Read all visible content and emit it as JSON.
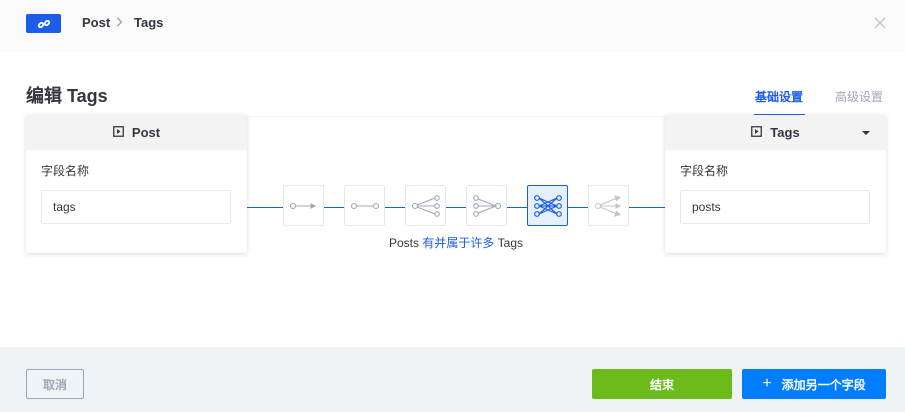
{
  "header": {
    "breadcrumb": [
      "Post",
      "Tags"
    ]
  },
  "main": {
    "title": "编辑 Tags",
    "tabs": [
      {
        "label": "基础设置",
        "active": true
      },
      {
        "label": "高级设置",
        "active": false
      }
    ]
  },
  "left_model": {
    "name": "Post",
    "field_label": "字段名称",
    "field_value": "tags"
  },
  "right_model": {
    "name": "Tags",
    "field_label": "字段名称",
    "field_value": "posts"
  },
  "relation": {
    "types": [
      {
        "icon": "one-way-icon",
        "active": false
      },
      {
        "icon": "one-to-one-icon",
        "active": false
      },
      {
        "icon": "one-to-many-icon",
        "active": false
      },
      {
        "icon": "many-to-one-icon",
        "active": false
      },
      {
        "icon": "many-to-many-icon",
        "active": true
      },
      {
        "icon": "many-way-icon",
        "active": false
      }
    ],
    "text_from": "Posts",
    "text_relation": "有并属于许多",
    "text_to": "Tags"
  },
  "footer": {
    "cancel_label": "取消",
    "finish_label": "结束",
    "add_label": "添加另一个字段",
    "add_icon": "plus-icon"
  },
  "colors": {
    "accent": "#1c5de7",
    "finish": "#6dbb1a",
    "add": "#007eff"
  }
}
